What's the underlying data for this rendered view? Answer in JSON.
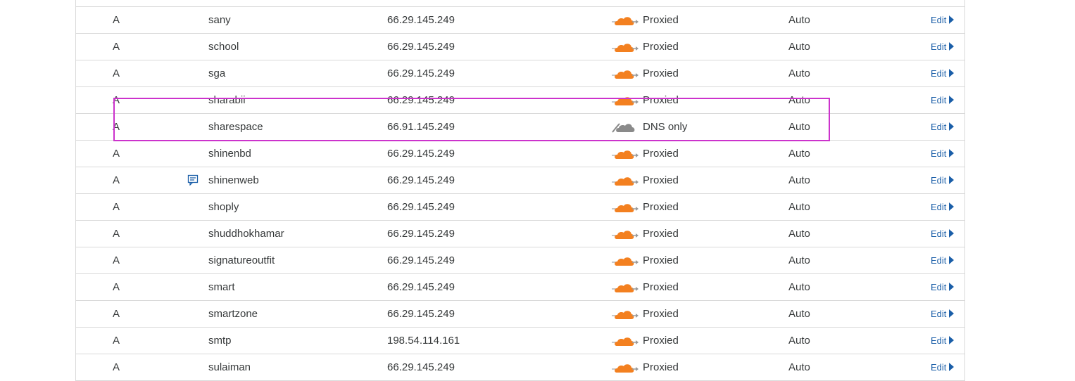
{
  "colors": {
    "proxied_cloud": "#f38020",
    "dns_only_cloud": "#8a8a8a",
    "highlight": "#cc33cc",
    "edit_link": "#1a5ea8"
  },
  "edit_label": "Edit",
  "rows": [
    {
      "type": "A",
      "name": "",
      "content": "",
      "status": "",
      "ttl": "",
      "cloud": "none",
      "comment": false,
      "edit": false
    },
    {
      "type": "A",
      "name": "sany",
      "content": "66.29.145.249",
      "status": "Proxied",
      "ttl": "Auto",
      "cloud": "proxied",
      "comment": false,
      "edit": true
    },
    {
      "type": "A",
      "name": "school",
      "content": "66.29.145.249",
      "status": "Proxied",
      "ttl": "Auto",
      "cloud": "proxied",
      "comment": false,
      "edit": true
    },
    {
      "type": "A",
      "name": "sga",
      "content": "66.29.145.249",
      "status": "Proxied",
      "ttl": "Auto",
      "cloud": "proxied",
      "comment": false,
      "edit": true
    },
    {
      "type": "A",
      "name": "sharabii",
      "content": "66.29.145.249",
      "status": "Proxied",
      "ttl": "Auto",
      "cloud": "proxied",
      "comment": false,
      "edit": true
    },
    {
      "type": "A",
      "name": "sharespace",
      "content": "66.91.145.249",
      "status": "DNS only",
      "ttl": "Auto",
      "cloud": "dns-only",
      "comment": false,
      "edit": true
    },
    {
      "type": "A",
      "name": "shinenbd",
      "content": "66.29.145.249",
      "status": "Proxied",
      "ttl": "Auto",
      "cloud": "proxied",
      "comment": false,
      "edit": true
    },
    {
      "type": "A",
      "name": "shinenweb",
      "content": "66.29.145.249",
      "status": "Proxied",
      "ttl": "Auto",
      "cloud": "proxied",
      "comment": true,
      "edit": true
    },
    {
      "type": "A",
      "name": "shoply",
      "content": "66.29.145.249",
      "status": "Proxied",
      "ttl": "Auto",
      "cloud": "proxied",
      "comment": false,
      "edit": true
    },
    {
      "type": "A",
      "name": "shuddhokhamar",
      "content": "66.29.145.249",
      "status": "Proxied",
      "ttl": "Auto",
      "cloud": "proxied",
      "comment": false,
      "edit": true
    },
    {
      "type": "A",
      "name": "signatureoutfit",
      "content": "66.29.145.249",
      "status": "Proxied",
      "ttl": "Auto",
      "cloud": "proxied",
      "comment": false,
      "edit": true
    },
    {
      "type": "A",
      "name": "smart",
      "content": "66.29.145.249",
      "status": "Proxied",
      "ttl": "Auto",
      "cloud": "proxied",
      "comment": false,
      "edit": true
    },
    {
      "type": "A",
      "name": "smartzone",
      "content": "66.29.145.249",
      "status": "Proxied",
      "ttl": "Auto",
      "cloud": "proxied",
      "comment": false,
      "edit": true
    },
    {
      "type": "A",
      "name": "smtp",
      "content": "198.54.114.161",
      "status": "Proxied",
      "ttl": "Auto",
      "cloud": "proxied",
      "comment": false,
      "edit": true
    },
    {
      "type": "A",
      "name": "sulaiman",
      "content": "66.29.145.249",
      "status": "Proxied",
      "ttl": "Auto",
      "cloud": "proxied",
      "comment": false,
      "edit": true
    }
  ]
}
